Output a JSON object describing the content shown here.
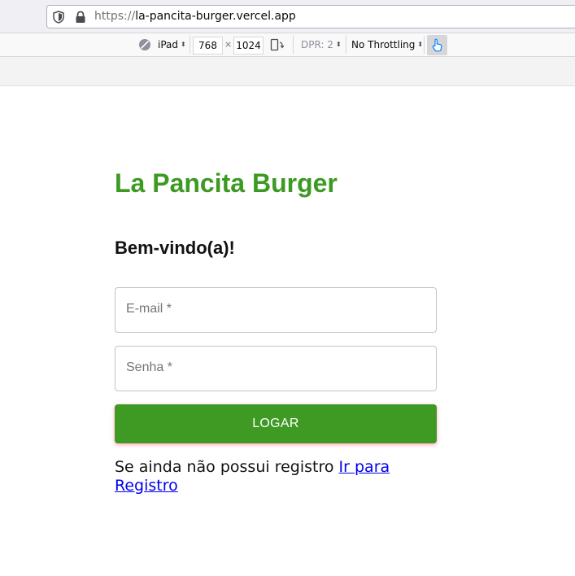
{
  "browser": {
    "url_scheme": "https://",
    "url_host": "la-pancita-burger.vercel.app"
  },
  "devtools": {
    "device": "iPad",
    "width": "768",
    "times": "×",
    "height": "1024",
    "dpr": "DPR: 2",
    "throttling": "No Throttling",
    "touch_simulation_enabled": true
  },
  "page": {
    "title": "La Pancita Burger",
    "welcome": "Bem-vindo(a)!",
    "email_label": "E-mail *",
    "password_label": "Senha *",
    "email_value": "",
    "password_value": "",
    "login_button": "LOGAR",
    "register_prompt": "Se ainda não possui registro ",
    "register_link": "Ir para Registro"
  },
  "colors": {
    "brand_green": "#3c9a22",
    "button_green": "#3e9a23",
    "link_blue": "#0000ee"
  }
}
